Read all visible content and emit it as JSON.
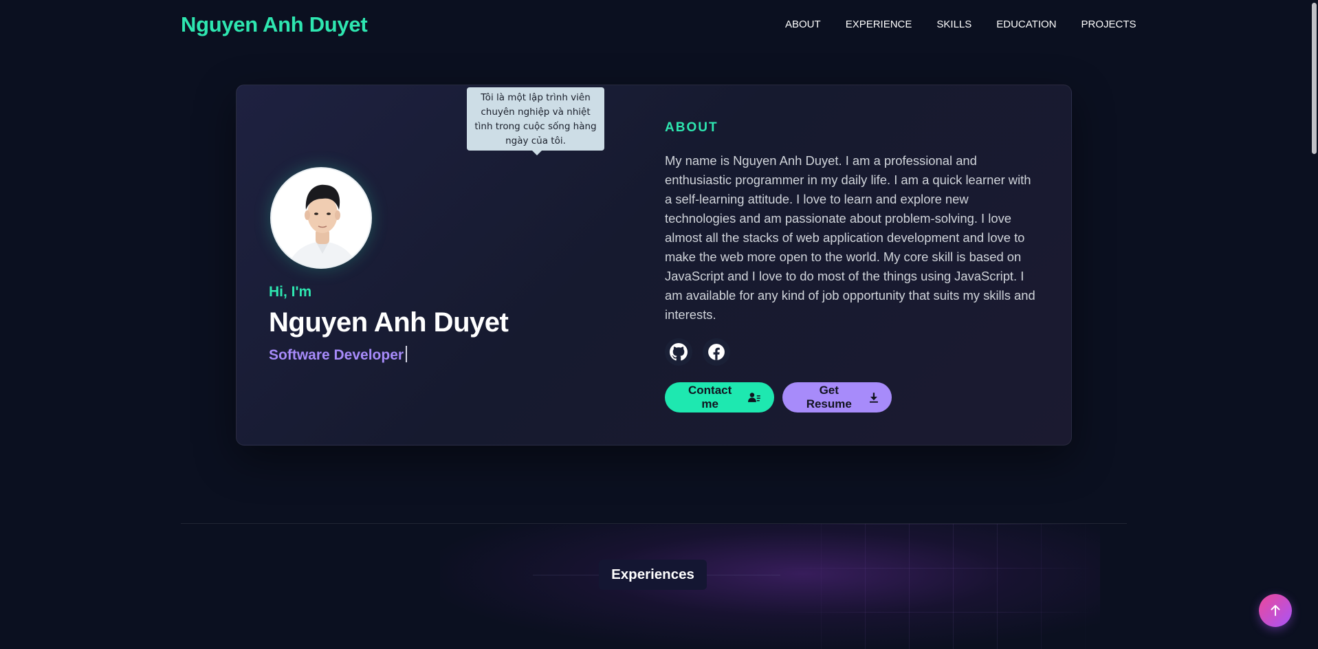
{
  "brand": "Nguyen Anh Duyet",
  "nav": {
    "items": [
      {
        "label": "ABOUT"
      },
      {
        "label": "EXPERIENCE"
      },
      {
        "label": "SKILLS"
      },
      {
        "label": "EDUCATION"
      },
      {
        "label": "PROJECTS"
      }
    ]
  },
  "hero": {
    "tooltip": "Tôi là một lập trình viên chuyên nghiệp và nhiệt tình trong cuộc sống hàng ngày của tôi.",
    "greeting": "Hi, I'm",
    "name": "Nguyen Anh Duyet",
    "role": "Software Developer"
  },
  "about": {
    "heading": "ABOUT",
    "text": "My name is Nguyen Anh Duyet. I am a professional and enthusiastic programmer in my daily life. I am a quick learner with a self-learning attitude. I love to learn and explore new technologies and am passionate about problem-solving. I love almost all the stacks of web application development and love to make the web more open to the world. My core skill is based on JavaScript and I love to do most of the things using JavaScript. I am available for any kind of job opportunity that suits my skills and interests.",
    "socials": [
      {
        "icon": "github-icon"
      },
      {
        "icon": "facebook-icon"
      }
    ],
    "buttons": {
      "contact_label": "Contact me",
      "resume_label": "Get Resume"
    }
  },
  "experience": {
    "title": "Experiences"
  },
  "colors": {
    "background": "#0b1020",
    "accent_green": "#2ee6b0",
    "accent_purple": "#a78bfa",
    "scroll_button_gradient": [
      "#ec4899",
      "#a855f7"
    ]
  },
  "icons": {
    "contact": "contact-card-icon",
    "resume": "download-icon",
    "scroll_top": "arrow-up-icon"
  }
}
